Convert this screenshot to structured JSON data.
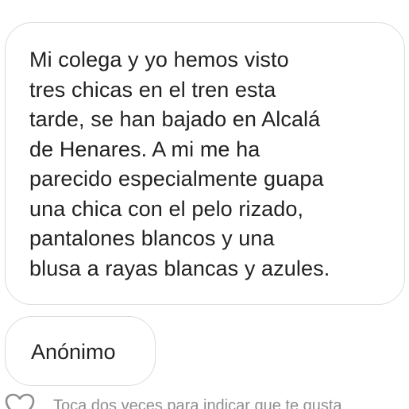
{
  "message": {
    "lines": [
      "Mi colega y yo hemos visto",
      "tres chicas en el tren esta",
      "tarde, se han bajado en Alcalá",
      "de Henares. A mi me ha",
      "parecido especialmente guapa",
      "una chica con el pelo rizado,",
      "pantalones blancos y una",
      "blusa a rayas blancas y azules."
    ]
  },
  "sender": {
    "name": "Anónimo"
  },
  "like_row": {
    "icon": "heart-outline-icon",
    "hint": "Toca dos veces para indicar que te gusta"
  },
  "colors": {
    "text": "#222222",
    "bubble_border": "#dcdcdc",
    "hint": "#8e8e8e"
  }
}
